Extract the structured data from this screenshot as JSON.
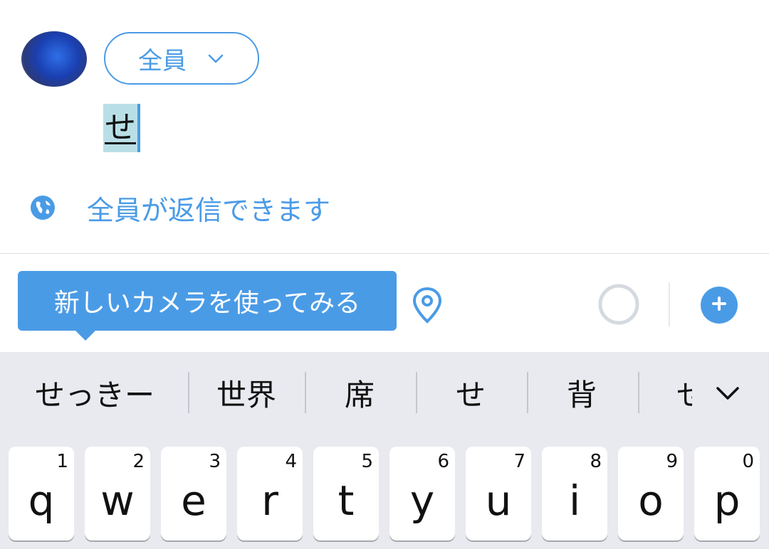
{
  "compose": {
    "audience_label": "全員",
    "text": "せ",
    "reply_setting": "全員が返信できます"
  },
  "toolbar": {
    "tooltip": "新しいカメラを使ってみる",
    "icons": [
      "location-pin-icon",
      "progress-ring-icon",
      "plus-icon"
    ]
  },
  "keyboard": {
    "candidates": [
      "せっきー",
      "世界",
      "席",
      "せ",
      "背",
      "せ"
    ],
    "keys": [
      {
        "num": "1",
        "letter": "q"
      },
      {
        "num": "2",
        "letter": "w"
      },
      {
        "num": "3",
        "letter": "e"
      },
      {
        "num": "4",
        "letter": "r"
      },
      {
        "num": "5",
        "letter": "t"
      },
      {
        "num": "6",
        "letter": "y"
      },
      {
        "num": "7",
        "letter": "u"
      },
      {
        "num": "8",
        "letter": "i"
      },
      {
        "num": "9",
        "letter": "o"
      },
      {
        "num": "0",
        "letter": "p"
      }
    ]
  },
  "colors": {
    "accent": "#4a9be6",
    "selection": "#b9dfe6",
    "keyboard_bg": "#e9eaf0"
  }
}
